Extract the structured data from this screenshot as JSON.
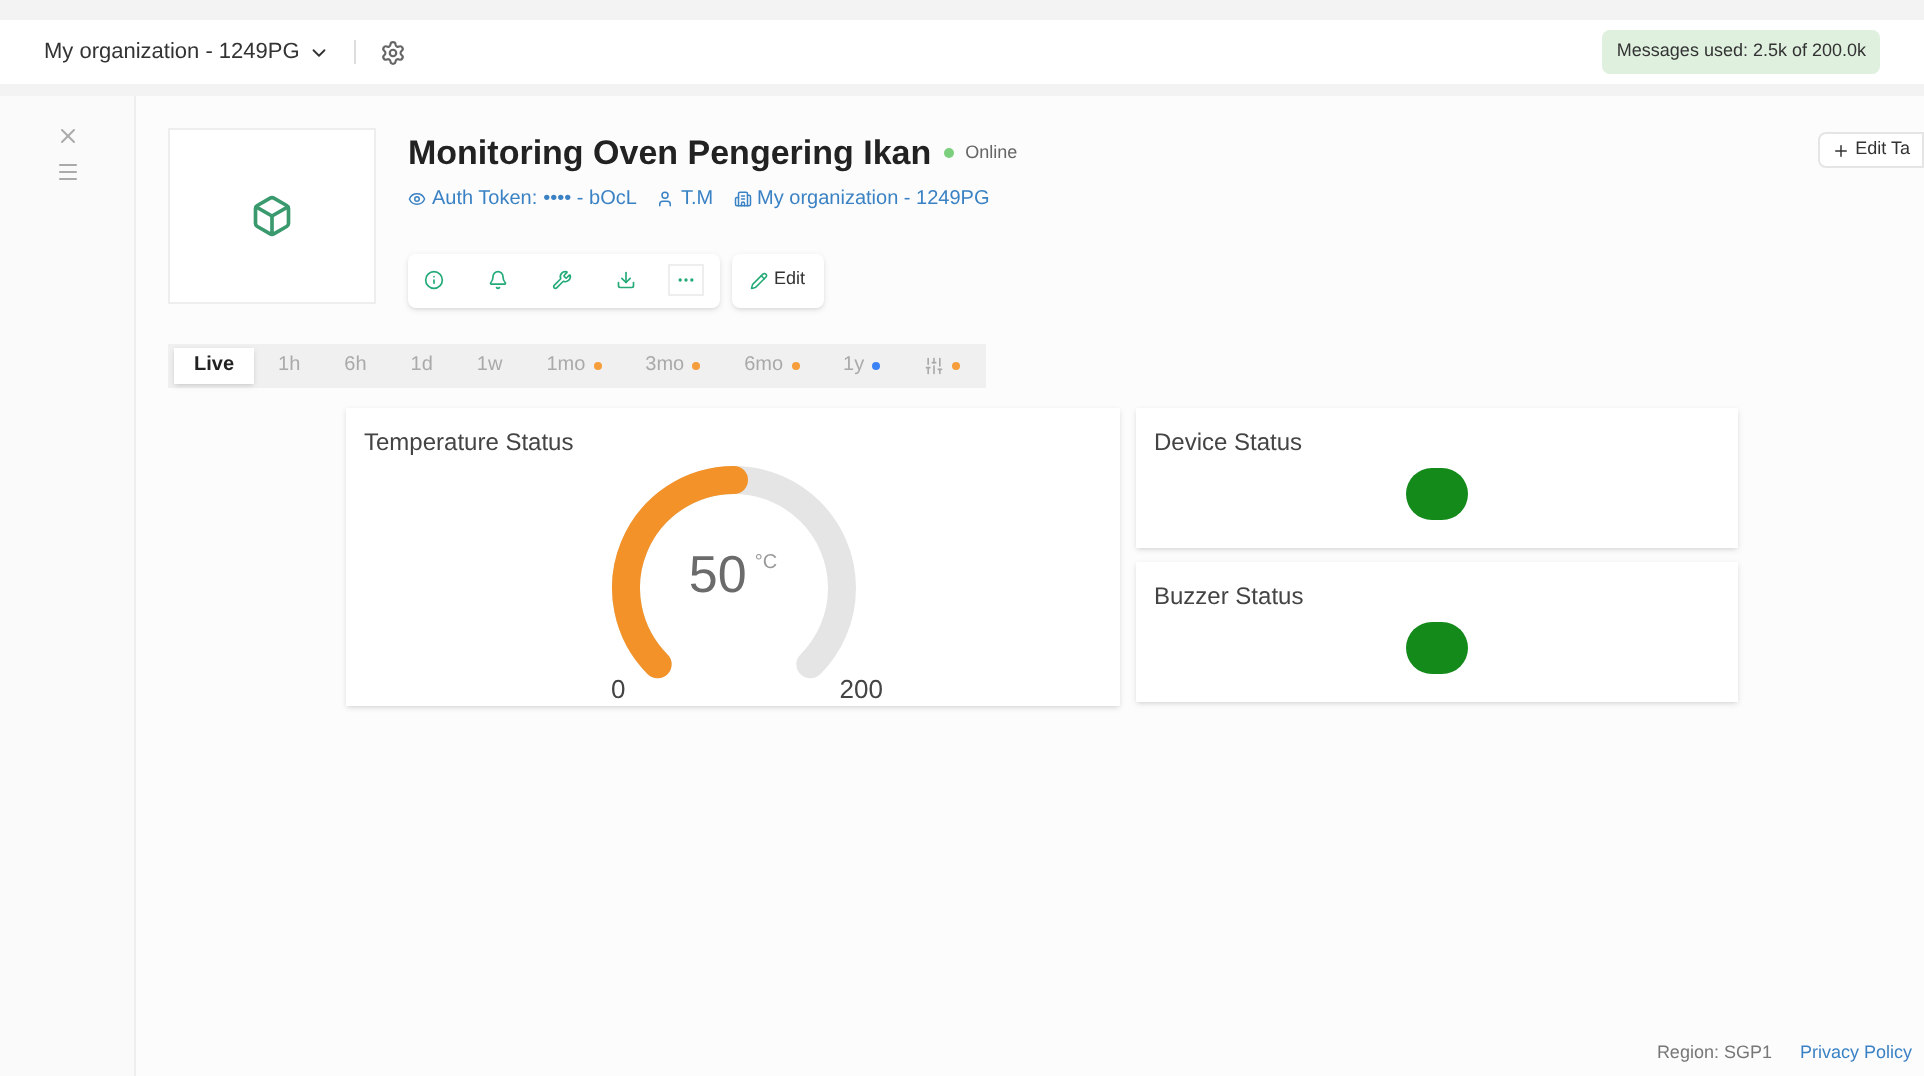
{
  "top_bar": {
    "organization": "My organization - 1249PG",
    "messages": "Messages used: 2.5k of 200.0k"
  },
  "device": {
    "name": "Monitoring Oven Pengering Ikan",
    "status": "Online",
    "online": true,
    "auth_label": "Auth Token:",
    "auth_value": "•••• - bOcL",
    "owner": "T.M",
    "organization": "My organization - 1249PG",
    "edit_button": "Edit",
    "edit_tags_button": "Edit Ta"
  },
  "time_ranges": [
    {
      "kind": "text",
      "label": "Live",
      "selected": true
    },
    {
      "kind": "text",
      "label": "1h",
      "selected": false
    },
    {
      "kind": "text",
      "label": "6h",
      "selected": false
    },
    {
      "kind": "text",
      "label": "1d",
      "selected": false
    },
    {
      "kind": "text",
      "label": "1w",
      "selected": false
    },
    {
      "kind": "text",
      "label": "1mo",
      "selected": false,
      "color": "#f59e3b"
    },
    {
      "kind": "text",
      "label": "3mo",
      "selected": false,
      "color": "#f59e3b"
    },
    {
      "kind": "text",
      "label": "6mo",
      "selected": false,
      "color": "#f59e3b"
    },
    {
      "kind": "text",
      "label": "1y",
      "selected": false,
      "color": "#3b82f6"
    },
    {
      "kind": "icon",
      "selected": false,
      "color": "#f59e3b"
    }
  ],
  "gauge": {
    "title": "Temperature Status",
    "value": "50",
    "unit": "°C",
    "min": "0",
    "max": "200"
  },
  "leds": [
    {
      "title": "Device Status",
      "color": "#138a1a"
    },
    {
      "title": "Buzzer Status",
      "color": "#138a1a"
    }
  ],
  "footer": {
    "region": "Region: SGP1",
    "privacy": "Privacy Policy"
  }
}
